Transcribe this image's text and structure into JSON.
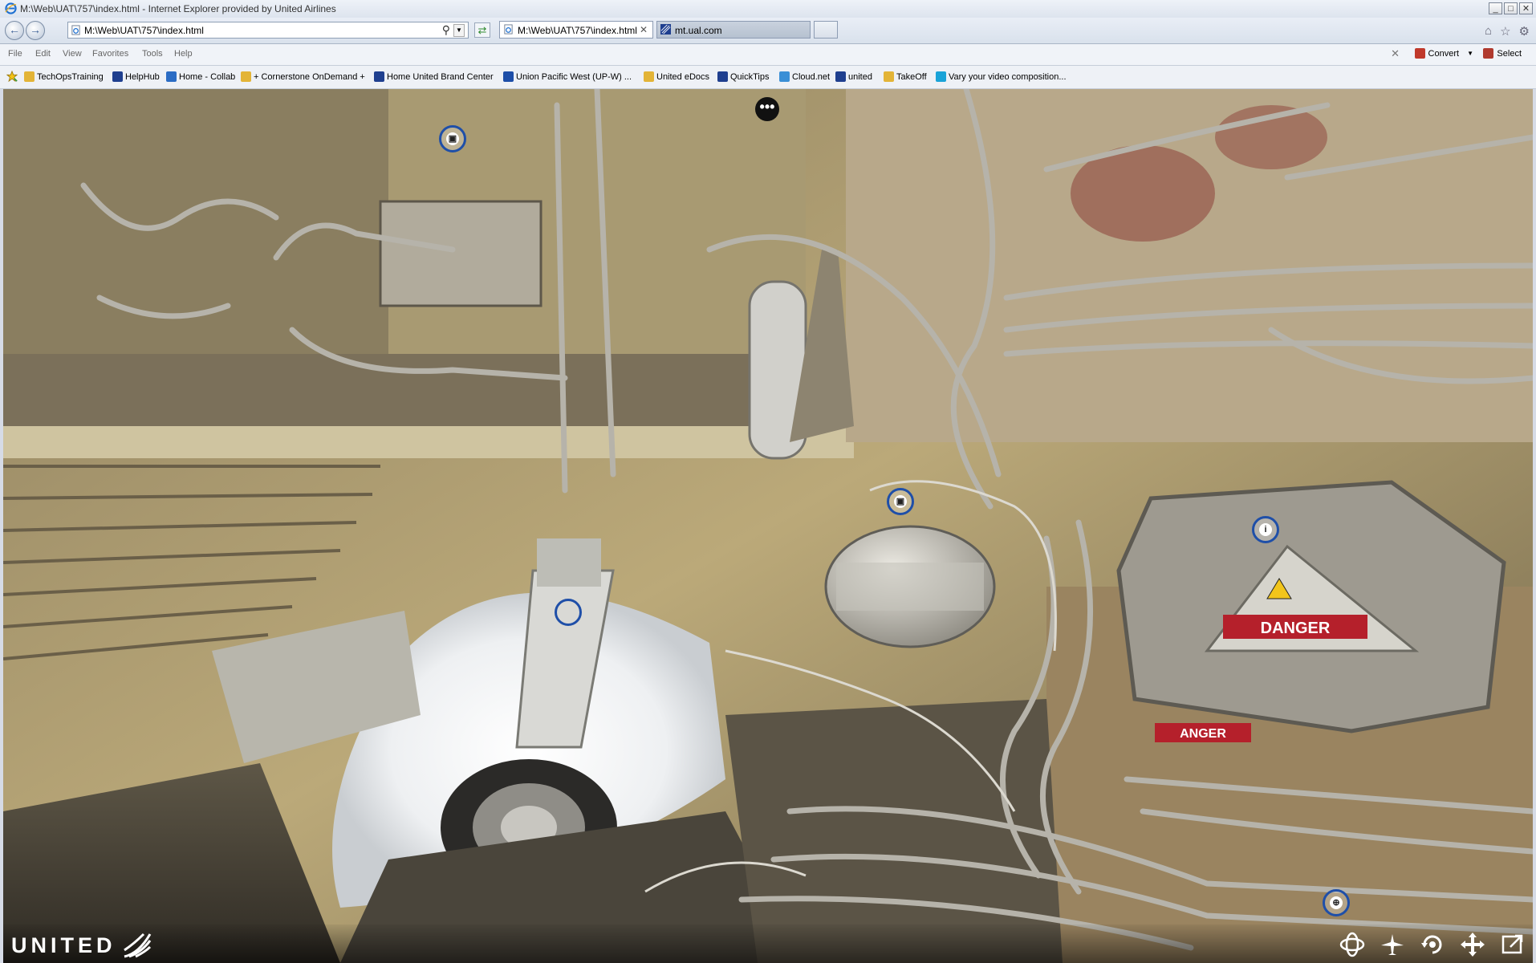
{
  "window": {
    "title": "M:\\Web\\UAT\\757\\index.html - Internet Explorer provided by United Airlines",
    "controls": {
      "minimize": "_",
      "maximize": "□",
      "close": "✕"
    }
  },
  "navbar": {
    "address": "M:\\Web\\UAT\\757\\index.html",
    "tabs": [
      {
        "label": "M:\\Web\\UAT\\757\\index.html",
        "close": "✕"
      },
      {
        "label": "mt.ual.com"
      }
    ]
  },
  "menubar": {
    "items": [
      "File",
      "Edit",
      "View",
      "Favorites",
      "Tools",
      "Help"
    ],
    "close": "✕",
    "convert_label": "Convert",
    "select_label": "Select"
  },
  "favorites": [
    {
      "label": "TechOpsTraining",
      "icon": "page-icon",
      "color": "#e3b437"
    },
    {
      "label": "HelpHub",
      "icon": "united-globe-icon",
      "color": "#1f3f8f"
    },
    {
      "label": "Home - Collab",
      "icon": "sharepoint-icon",
      "color": "#2b6cc4"
    },
    {
      "label": "+ Cornerstone OnDemand +",
      "icon": "page-icon",
      "color": "#e3b437"
    },
    {
      "label": "Home  United Brand Center",
      "icon": "united-globe-icon",
      "color": "#1f3f8f"
    },
    {
      "label": "Union Pacific West (UP-W)  ...",
      "icon": "m-logo-icon",
      "color": "#1d4ea8"
    },
    {
      "label": "United eDocs",
      "icon": "page-icon",
      "color": "#e3b437"
    },
    {
      "label": "QuickTips",
      "icon": "united-globe-icon",
      "color": "#1f3f8f"
    },
    {
      "label": "Cloud.net",
      "icon": "cloud-icon",
      "color": "#3a8fd6"
    },
    {
      "label": "united",
      "icon": "united-tulip-icon",
      "color": "#1f3f8f"
    },
    {
      "label": "TakeOff",
      "icon": "page-icon",
      "color": "#e3b437"
    },
    {
      "label": "Vary your video composition...",
      "icon": "v-logo-icon",
      "color": "#1aa3d8"
    }
  ],
  "viewer": {
    "brand": "UNITED",
    "menu_dots": "•••",
    "hotspots": [
      {
        "type": "image",
        "glyph": "▣"
      },
      {
        "type": "image",
        "glyph": "▣"
      },
      {
        "type": "info",
        "glyph": "i"
      },
      {
        "type": "link",
        "glyph": ""
      },
      {
        "type": "globe",
        "glyph": "⊕"
      }
    ],
    "controls": [
      "vr-mode",
      "gyro",
      "autorotate",
      "move",
      "fullscreen"
    ]
  }
}
